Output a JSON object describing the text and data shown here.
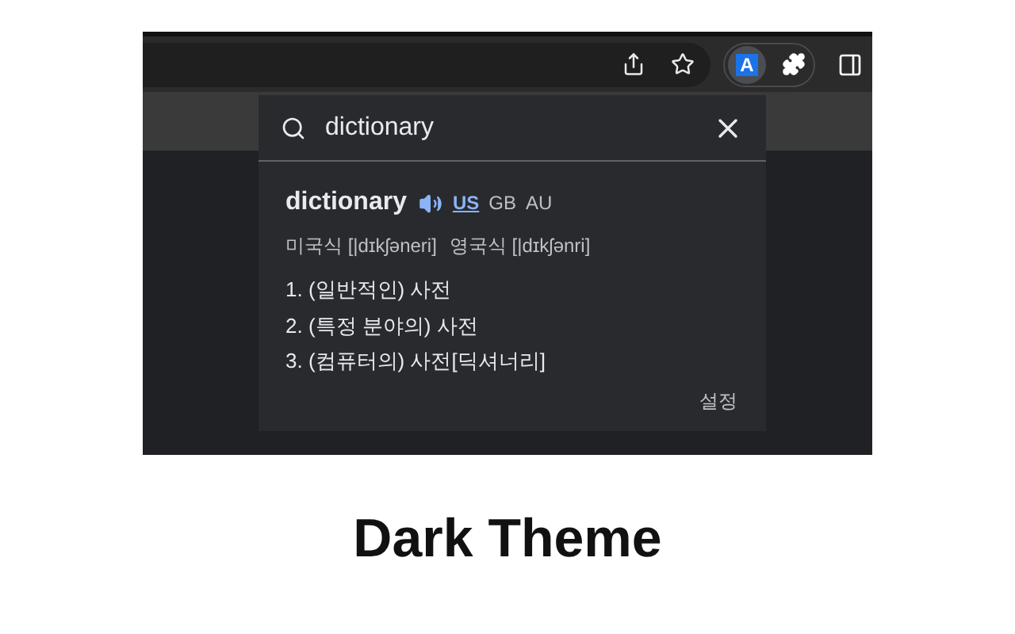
{
  "extension_badge": "A",
  "search": {
    "value": "dictionary"
  },
  "entry": {
    "word": "dictionary",
    "accents": [
      {
        "label": "US",
        "selected": true
      },
      {
        "label": "GB",
        "selected": false
      },
      {
        "label": "AU",
        "selected": false
      }
    ],
    "pronunciations": [
      "미국식 [|dɪkʃəneri]",
      "영국식 [|dɪkʃənri]"
    ],
    "definitions": [
      "1. (일반적인) 사전",
      "2. (특정 분야의) 사전",
      "3. (컴퓨터의) 사전[딕셔너리]"
    ]
  },
  "settings_link": "설정",
  "caption": "Dark Theme"
}
